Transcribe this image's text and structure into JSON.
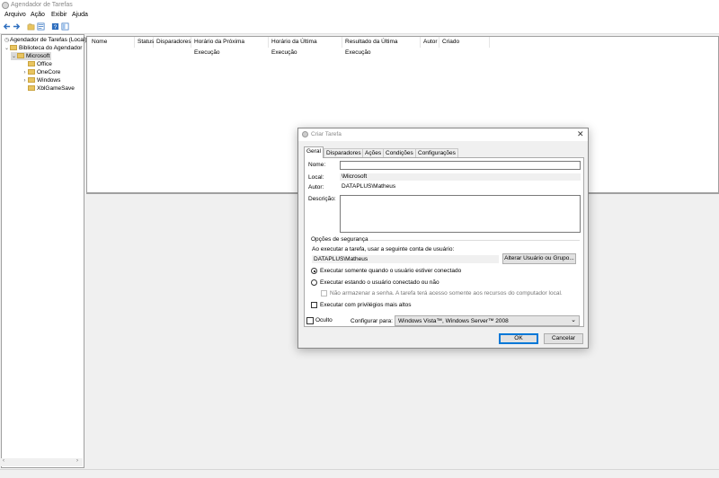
{
  "window": {
    "title": "Agendador de Tarefas"
  },
  "menu": [
    "Arquivo",
    "Ação",
    "Exibir",
    "Ajuda"
  ],
  "tree": {
    "root": "Agendador de Tarefas (Local)",
    "library": "Biblioteca do Agendador",
    "microsoft": "Microsoft",
    "children": [
      "Office",
      "OneCore",
      "Windows",
      "XblGameSave"
    ]
  },
  "list": {
    "columns": [
      "Nome",
      "Status",
      "Disparadores",
      "Horário da Próxima Execução",
      "Horário da Última Execução",
      "Resultado da Última Execução",
      "Autor",
      "Criado"
    ]
  },
  "dialog": {
    "title": "Criar Tarefa",
    "tabs": [
      "Geral",
      "Disparadores",
      "Ações",
      "Condições",
      "Configurações"
    ],
    "active_tab": "Geral",
    "name_label": "Nome:",
    "name_value": "",
    "location_label": "Local:",
    "location_value": "\\Microsoft",
    "author_label": "Autor:",
    "author_value": "DATAPLUS\\Matheus",
    "description_label": "Descrição:",
    "description_value": "",
    "security_group": "Opções de segurança",
    "run_as_text": "Ao executar a tarefa, usar a seguinte conta de usuário:",
    "run_as_user": "DATAPLUS\\Matheus",
    "change_user_button": "Alterar Usuário ou Grupo...",
    "radio_logged_on": "Executar somente quando o usuário estiver conectado",
    "radio_whether": "Executar estando o usuário conectado ou não",
    "no_store_password": "Não armazenar a senha. A tarefa terá acesso somente aos recursos do computador local.",
    "highest_privileges": "Executar com privilégios mais altos",
    "hidden_label": "Oculto",
    "configure_for_label": "Configurar para:",
    "configure_for_value": "Windows Vista™, Windows Server™ 2008",
    "ok_button": "OK",
    "cancel_button": "Cancelar"
  },
  "icons": {
    "back": "arrow-left-icon",
    "forward": "arrow-right-icon",
    "folder_up": "folder-icon",
    "properties": "properties-icon",
    "help": "help-icon",
    "view": "view-icon",
    "close": "close-icon"
  },
  "colors": {
    "accent": "#0078d7",
    "folder": "#e8c460"
  }
}
